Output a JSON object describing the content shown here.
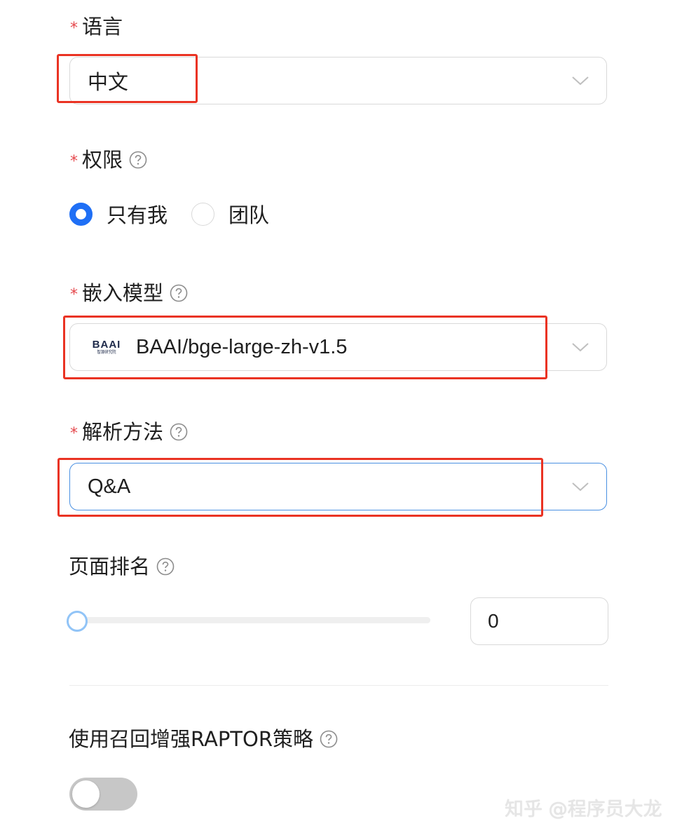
{
  "language": {
    "required_mark": "*",
    "label": "语言",
    "value": "中文",
    "chevron_icon": "chevron-down-icon"
  },
  "permission": {
    "required_mark": "*",
    "label": "权限",
    "help_icon": "question-circle-icon",
    "options": [
      {
        "label": "只有我",
        "selected": true
      },
      {
        "label": "团队",
        "selected": false
      }
    ]
  },
  "embedding_model": {
    "required_mark": "*",
    "label": "嵌入模型",
    "help_icon": "question-circle-icon",
    "logo_text": "BAAI",
    "logo_subtext": "智源研究院",
    "value": "BAAI/bge-large-zh-v1.5",
    "chevron_icon": "chevron-down-icon"
  },
  "parse_method": {
    "required_mark": "*",
    "label": "解析方法",
    "help_icon": "question-circle-icon",
    "value": "Q&A",
    "chevron_icon": "chevron-down-icon"
  },
  "page_rank": {
    "label": "页面排名",
    "help_icon": "question-circle-icon",
    "slider_value": 0,
    "input_value": "0"
  },
  "raptor": {
    "label": "使用召回增强RAPTOR策略",
    "help_icon": "question-circle-icon",
    "enabled": false
  },
  "watermark": "知乎 @程序员大龙",
  "colors": {
    "primary": "#1f6ff5",
    "required": "#e5484d",
    "annotation": "#ea3323",
    "border": "#d9d9d9",
    "focus_border": "#4a90e2"
  }
}
